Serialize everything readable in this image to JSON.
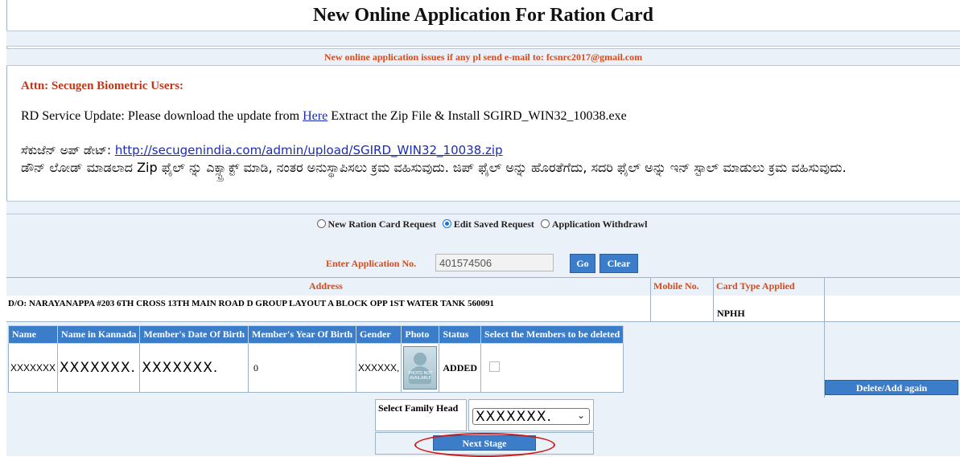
{
  "page": {
    "title": "New Online Application For Ration Card",
    "notice": "New online application issues if any pl send e-mail to: fcsnrc2017@gmail.com"
  },
  "announcement": {
    "attn": "Attn: Secugen Biometric Users:",
    "rd_prefix": "RD Service Update: Please download the update from ",
    "rd_link": "Here",
    "rd_suffix": " Extract the Zip File & Install SGIRD_WIN32_10038.exe",
    "kn_prefix": "ಸೆಕುಜೆನ್ ಅಪ್ ಡೇಟ್: ",
    "kn_link": "http://secugenindia.com/admin/upload/SGIRD_WIN32_10038.zip",
    "kn_text": "ಡೌನ್ ಲೋಡ್ ಮಾಡಲಾದ Zip ಫೈಲ್ ನ್ನು ಎಕ್ಸ್ಟ್ರಾಕ್ಟ್ ಮಾಡಿ, ನಂತರ ಅನುಸ್ಥಾಪಿಸಲು ಕ್ರಮ ವಹಿಸುವುದು. ಜಿಪ್ ಫೈಲ್ ಅನ್ನು ಹೊರತೆಗೆದು, ಸದರಿ ಫೈಲ್ ಅನ್ನು ಇನ್ ಸ್ಟಾಲ್ ಮಾಡುಲು ಕ್ರಮ ವಹಿಸುವುದು."
  },
  "request_options": {
    "items": [
      {
        "label": "New Ration Card Request",
        "selected": false
      },
      {
        "label": "Edit Saved Request",
        "selected": true
      },
      {
        "label": "Application Withdrawl",
        "selected": false
      }
    ]
  },
  "application": {
    "label": "Enter Application No.",
    "value": "401574506",
    "go_label": "Go",
    "clear_label": "Clear"
  },
  "address_table": {
    "headers": {
      "address": "Address",
      "mobile": "Mobile No.",
      "card_type": "Card Type Applied"
    },
    "address": "D/O: NARAYANAPPA #203 6TH CROSS 13TH MAIN ROAD D GROUP LAYOUT A BLOCK OPP 1ST WATER TANK 560091",
    "mobile": "",
    "card_type": "NPHH"
  },
  "members_table": {
    "headers": [
      "Name",
      "Name in Kannada",
      "Member's Date Of Birth",
      "Member's Year Of Birth",
      "Gender",
      "Photo",
      "Status",
      "Select the Members to be deleted"
    ],
    "rows": [
      {
        "name": "XXXXXXX",
        "name_kannada": "XXXXXXX.",
        "dob": "XXXXXXX.",
        "yob": "0",
        "gender": "XXXXXX,",
        "photo_text": "PHOTO NOT AVAILABLE",
        "status": "ADDED"
      }
    ],
    "delete_add_label": "Delete/Add again"
  },
  "family_head": {
    "label": "Select Family Head",
    "selected": "XXXXXXX."
  },
  "next_stage_label": "Next Stage",
  "colors": {
    "accent": "#3b7dc8",
    "notice": "#d84a1b",
    "panel": "#eaf1f8",
    "highlight": "#cc1b1b"
  }
}
